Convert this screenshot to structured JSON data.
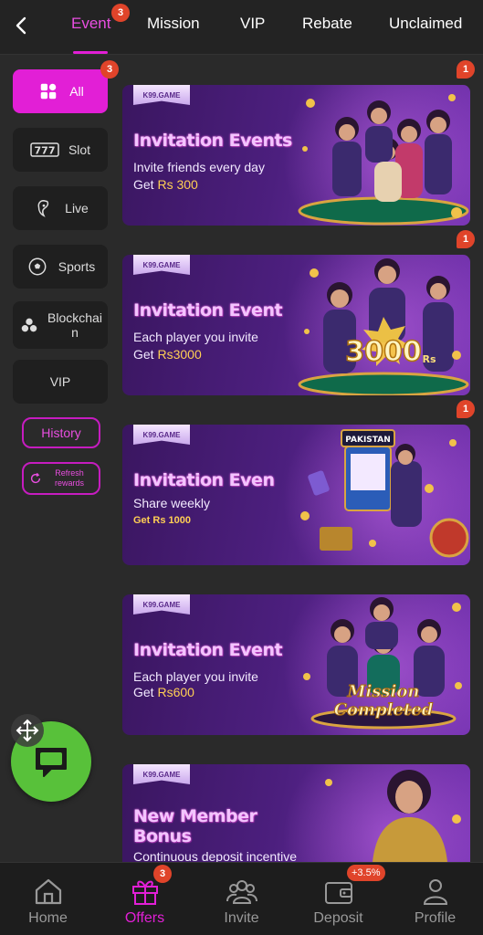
{
  "tabs": [
    {
      "label": "Event",
      "badge": "3",
      "active": true
    },
    {
      "label": "Mission"
    },
    {
      "label": "VIP"
    },
    {
      "label": "Rebate"
    },
    {
      "label": "Unclaimed"
    }
  ],
  "sidebar": {
    "items": [
      {
        "label": "All",
        "badge": "3",
        "icon": "grid-icon",
        "active": true
      },
      {
        "label": "Slot",
        "icon": "slot-777-icon"
      },
      {
        "label": "Live",
        "icon": "live-dealer-icon"
      },
      {
        "label": "Sports",
        "icon": "soccer-ball-icon"
      },
      {
        "label": "Blockchain",
        "icon": "blockchain-icon"
      },
      {
        "label": "VIP"
      }
    ],
    "history_label": "History",
    "refresh_label": "Refresh rewards"
  },
  "banners": [
    {
      "tag": "K99.GAME",
      "title": "Invitation Events",
      "line1": "Invite friends every day",
      "line2_prefix": "Get ",
      "line2_amount": "Rs 300",
      "badge": "1"
    },
    {
      "tag": "K99.GAME",
      "title": "Invitation Event",
      "line1": "Each player you invite",
      "line2_prefix": "Get ",
      "line2_amount": "Rs3000",
      "art_text": "3000",
      "art_suffix": "Rs",
      "badge": "1"
    },
    {
      "tag": "K99.GAME",
      "title": "Invitation Even",
      "line1": "Share weekly",
      "line2_small": "Get Rs 1000",
      "art_text": "PAKISTAN",
      "badge": "1"
    },
    {
      "tag": "K99.GAME",
      "title": "Invitation Event",
      "line1": "Each player you invite",
      "line2_prefix": "Get ",
      "line2_amount": "Rs600",
      "art_text": "Mission",
      "art_text2": "Completed"
    },
    {
      "tag": "K99.GAME",
      "title": "New Member",
      "title2": "Bonus",
      "line1": "Continuous deposit incentive"
    }
  ],
  "bottom_nav": [
    {
      "label": "Home",
      "icon": "home-icon"
    },
    {
      "label": "Offers",
      "icon": "gift-icon",
      "badge": "3",
      "active": true
    },
    {
      "label": "Invite",
      "icon": "invite-people-icon"
    },
    {
      "label": "Deposit",
      "icon": "wallet-icon",
      "badge": "+3.5%"
    },
    {
      "label": "Profile",
      "icon": "person-icon"
    }
  ],
  "colors": {
    "accent": "#e21fd6",
    "badge": "#e0442a",
    "chat_button": "#58c13a",
    "gold": "#ffcf54"
  }
}
